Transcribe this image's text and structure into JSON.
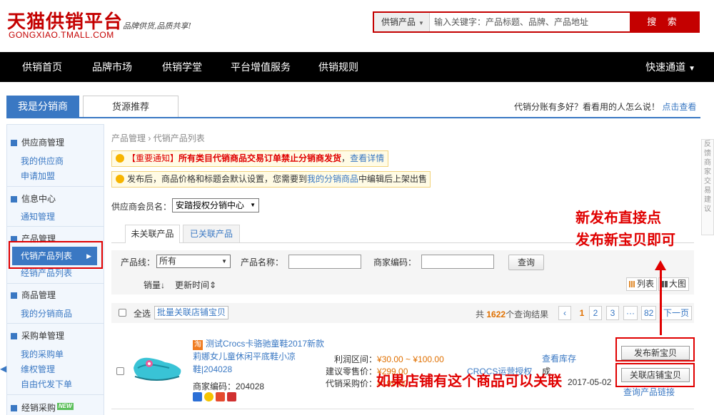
{
  "header": {
    "logo_text": "天猫供销平台",
    "slogan": "品牌供货,品质共享!",
    "domain": "GONGXIAO.TMALL.COM",
    "search": {
      "category": "供销产品",
      "placeholder": "输入关键字：产品标题、品牌、产品地址",
      "button": "搜 索"
    }
  },
  "nav": {
    "items": [
      "供销首页",
      "品牌市场",
      "供销学堂",
      "平台增值服务",
      "供销规则"
    ],
    "quick": "快速通道"
  },
  "tabs": {
    "active": "我是分销商",
    "other": "货源推荐",
    "promo_text": "代销分账有多好？看看用的人怎么说！",
    "promo_link": "点击查看"
  },
  "sidebar": {
    "groups": [
      {
        "title": "供应商管理",
        "links": [
          "我的供应商",
          "申请加盟"
        ]
      },
      {
        "title": "信息中心",
        "links": [
          "通知管理"
        ]
      },
      {
        "title": "产品管理",
        "active": "代销产品列表",
        "links": [
          "经销产品列表"
        ]
      },
      {
        "title": "商品管理",
        "links": [
          "我的分销商品"
        ]
      },
      {
        "title": "采购单管理",
        "links": [
          "我的采购单",
          "维权管理",
          "自由代发下单"
        ]
      },
      {
        "title": "经销采购",
        "badge": "NEW"
      }
    ]
  },
  "breadcrumb": {
    "root": "产品管理",
    "sep": "›",
    "current": "代销产品列表"
  },
  "notices": {
    "n1": {
      "prefix": "【重要通知】",
      "bold": "所有类目代销商品交易订单",
      "red": "禁止分销商发货",
      "comma": "，",
      "link": "查看详情"
    },
    "n2": {
      "text1": "发布后，商品价格和标题会默认设置，您需要到",
      "link": "我的分销商品",
      "text2": "中编辑后上架出售"
    }
  },
  "supplier": {
    "label": "供应商会员名：",
    "value": "安踏授权分销中心"
  },
  "subtabs": {
    "active": "未关联产品",
    "other": "已关联产品"
  },
  "filters": {
    "product_line_label": "产品线：",
    "product_line_value": "所有",
    "name_label": "产品名称：",
    "code_label": "商家编码：",
    "query_button": "查询",
    "sort_sales": "销量",
    "sort_time": "更新时间",
    "view_list": "列表",
    "view_grid": "大图"
  },
  "listbar": {
    "select_all": "全选",
    "bulk_button": "批量关联店铺宝贝",
    "total_prefix": "共",
    "total_count": "1622",
    "total_suffix": "个查询结果",
    "pages": [
      "1",
      "2",
      "3",
      "···",
      "82"
    ],
    "next": "下一页"
  },
  "product": {
    "title": "测试Crocs卡骆驰童鞋2017新款莉娜女儿童休闲平底鞋小凉鞋|204028",
    "tao_icon": "淘",
    "code": "商家编码：204028",
    "profit_label": "利润区间：",
    "profit_value": "¥30.00 ~ ¥100.00",
    "retail_label": "建议零售价：",
    "retail_value": "¥299.00",
    "purchase_label": "代销采购价：",
    "purchase_value": "¥199.00",
    "brand_link": "CROCS运营授权",
    "stock_link": "查看库存",
    "date": "2017-05-02",
    "status_frag": "成",
    "publish_button": "发布新宝贝",
    "relate_button": "关联店铺宝贝",
    "relate_link": "查询产品链接"
  },
  "annotations": {
    "a1_line1": "新发布直接点",
    "a1_line2": "发布新宝贝即可",
    "a2": "如果店铺有这个商品可以关联"
  },
  "right_panel": [
    "反",
    "馈",
    "商",
    "家",
    "交",
    "易",
    "建",
    "议"
  ],
  "colors": {
    "brand_red": "#c40000",
    "nav_black": "#000000",
    "blue": "#3a78c3",
    "annotation_red": "#e00000",
    "price_orange": "#e07000"
  }
}
